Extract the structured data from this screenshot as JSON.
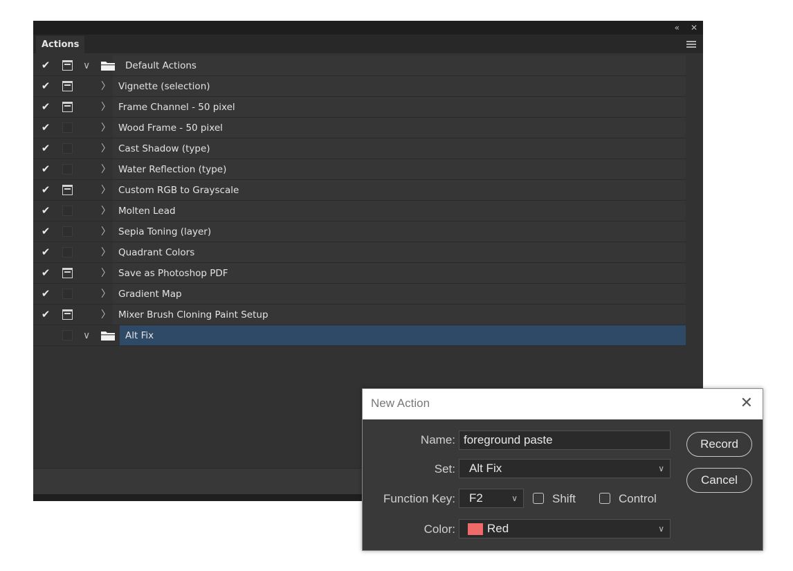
{
  "panel": {
    "title": "Actions",
    "collapse_icon": "«",
    "close_icon": "✕",
    "rows": [
      {
        "label": "Default Actions",
        "checked": true,
        "dialog": true,
        "type": "set",
        "expanded": true
      },
      {
        "label": "Vignette (selection)",
        "checked": true,
        "dialog": true,
        "type": "action"
      },
      {
        "label": "Frame Channel - 50 pixel",
        "checked": true,
        "dialog": true,
        "type": "action"
      },
      {
        "label": "Wood Frame - 50 pixel",
        "checked": true,
        "dialog": false,
        "type": "action"
      },
      {
        "label": "Cast Shadow (type)",
        "checked": true,
        "dialog": false,
        "type": "action"
      },
      {
        "label": "Water Reflection (type)",
        "checked": true,
        "dialog": false,
        "type": "action"
      },
      {
        "label": "Custom RGB to Grayscale",
        "checked": true,
        "dialog": true,
        "type": "action"
      },
      {
        "label": "Molten Lead",
        "checked": true,
        "dialog": false,
        "type": "action"
      },
      {
        "label": "Sepia Toning (layer)",
        "checked": true,
        "dialog": false,
        "type": "action"
      },
      {
        "label": "Quadrant Colors",
        "checked": true,
        "dialog": false,
        "type": "action"
      },
      {
        "label": "Save as Photoshop PDF",
        "checked": true,
        "dialog": true,
        "type": "action"
      },
      {
        "label": "Gradient Map",
        "checked": true,
        "dialog": false,
        "type": "action"
      },
      {
        "label": "Mixer Brush Cloning Paint Setup",
        "checked": true,
        "dialog": true,
        "type": "action"
      },
      {
        "label": "Alt Fix",
        "checked": false,
        "dialog": false,
        "type": "set",
        "expanded": true,
        "selected": true
      }
    ]
  },
  "dialog": {
    "title": "New Action",
    "close_icon": "✕",
    "name_label": "Name:",
    "name_value": "foreground paste",
    "set_label": "Set:",
    "set_value": "Alt Fix",
    "function_key_label": "Function Key:",
    "function_key_value": "F2",
    "shift_label": "Shift",
    "control_label": "Control",
    "color_label": "Color:",
    "color_value": "Red",
    "color_swatch": "#f06a6a",
    "record_label": "Record",
    "cancel_label": "Cancel"
  }
}
